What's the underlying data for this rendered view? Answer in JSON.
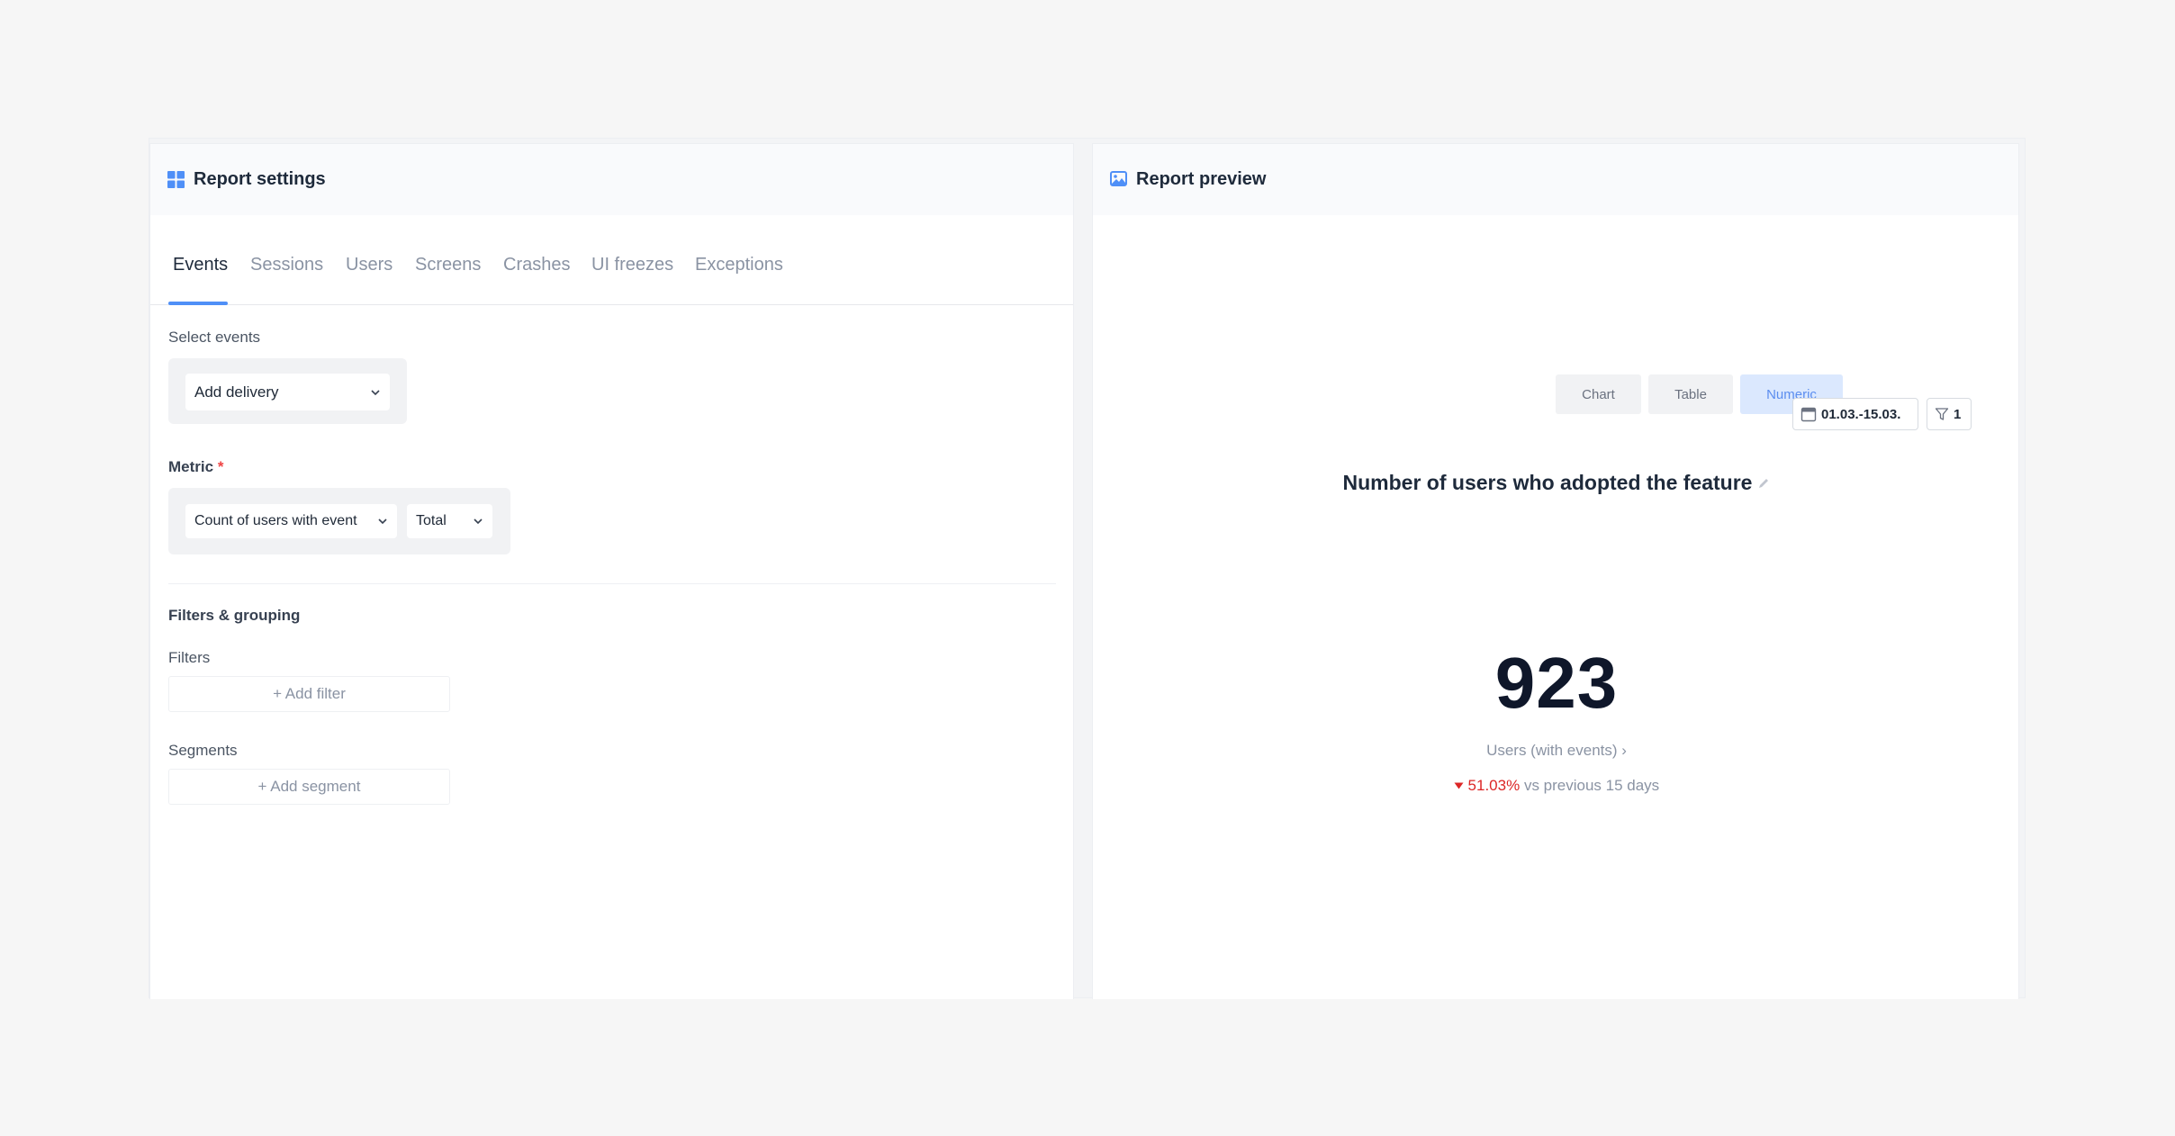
{
  "settings": {
    "title": "Report settings",
    "tabs": [
      "Events",
      "Sessions",
      "Users",
      "Screens",
      "Crashes",
      "UI freezes",
      "Exceptions"
    ],
    "select_events_label": "Select events",
    "selected_event": "Add delivery",
    "metric_label": "Metric",
    "metric_required_mark": "*",
    "metric_value": "Count of users with event",
    "aggregation_value": "Total",
    "filters_grouping_label": "Filters & grouping",
    "filters_label": "Filters",
    "add_filter": "+ Add filter",
    "segments_label": "Segments",
    "add_segment": "+ Add segment"
  },
  "preview": {
    "title": "Report preview",
    "view_modes": [
      "Chart",
      "Table",
      "Numeric"
    ],
    "active_view": "Numeric",
    "report_name": "Number of users who adopted the feature",
    "date_range": "01.03.-15.03.",
    "filter_count": "1",
    "value": "923",
    "caption": "Users (with events) ›",
    "delta_percent": "51.03%",
    "delta_text": "vs previous 15 days",
    "delta_direction": "down",
    "colors": {
      "accent": "#4f8ff7",
      "negative": "#dc2626",
      "active_view_bg": "#dbe8fe"
    }
  },
  "icons": {
    "settings_header": "grid-icon",
    "preview_header": "image-icon",
    "date": "calendar-icon",
    "filter": "funnel-icon",
    "edit": "pencil-icon",
    "dropdown": "chevron-down-icon"
  }
}
